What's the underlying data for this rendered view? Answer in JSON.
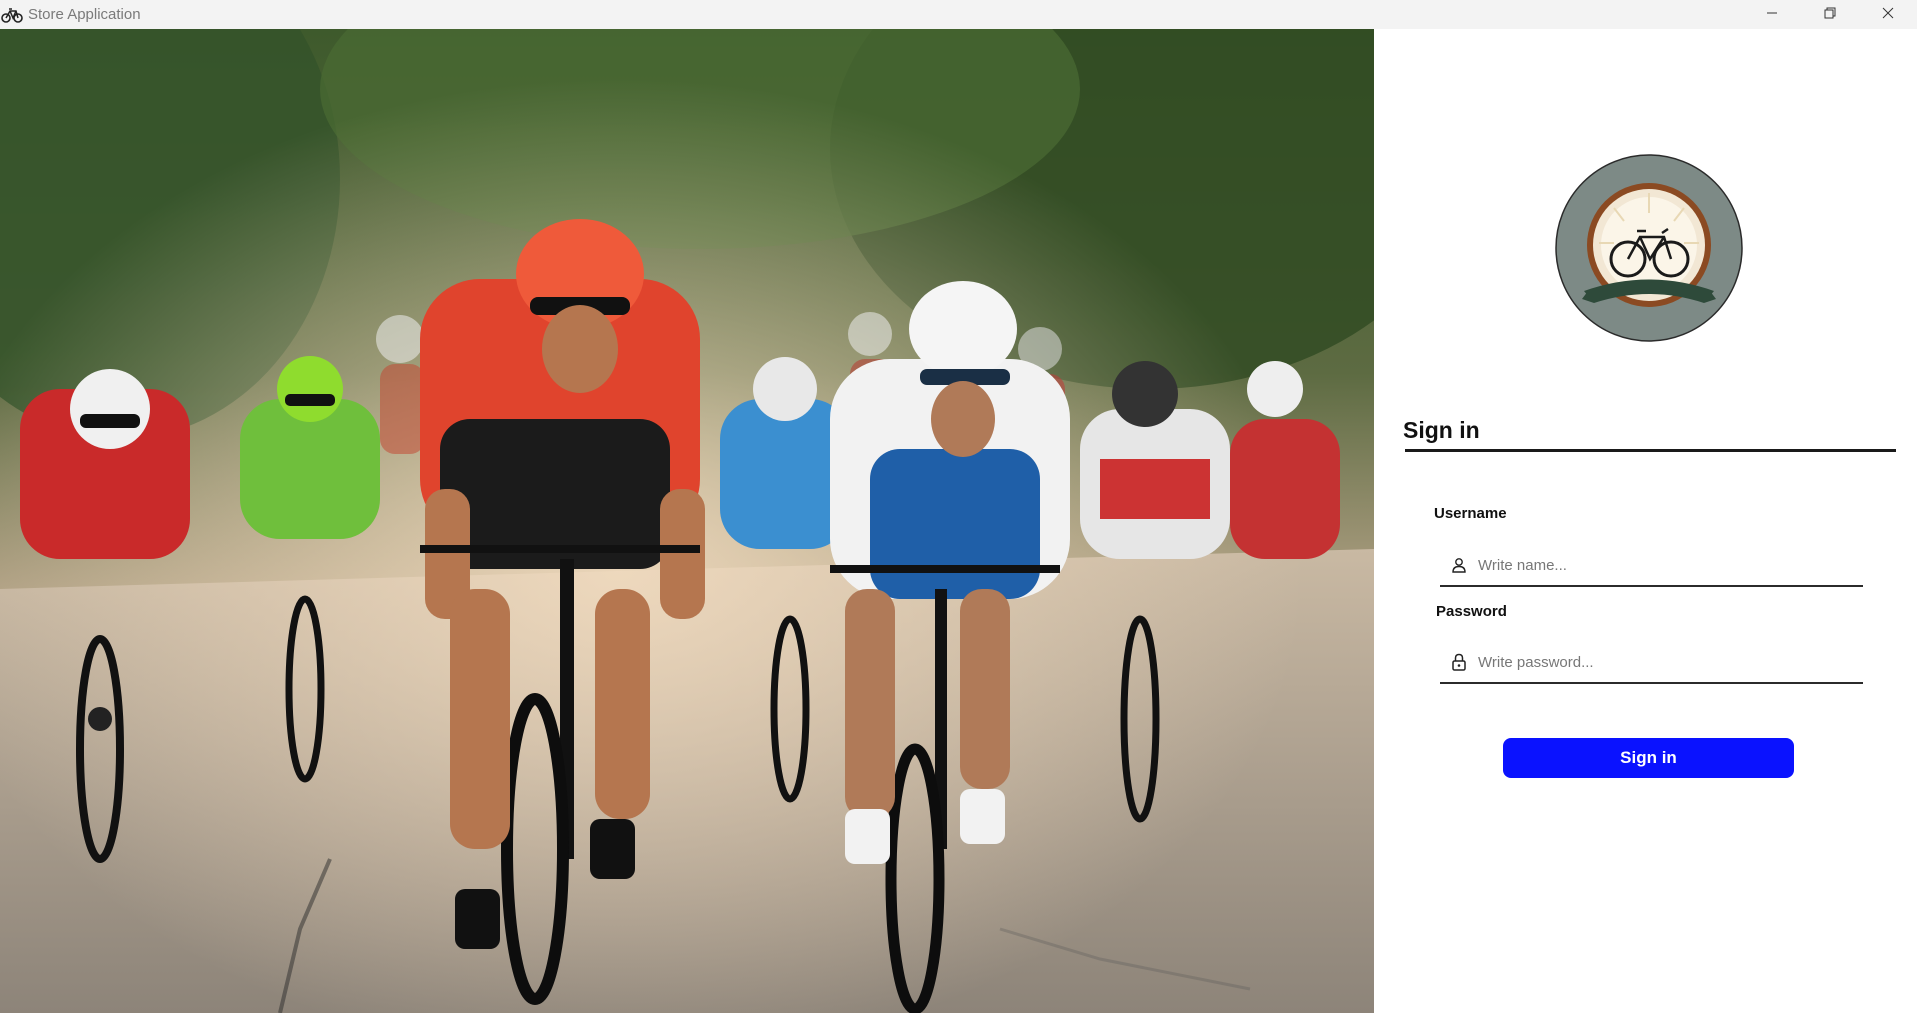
{
  "window": {
    "title": "Store Application",
    "app_icon": "bicycle-icon",
    "controls": [
      "minimize-icon",
      "restore-icon",
      "close-icon"
    ]
  },
  "hero": {
    "image": "photo of a group of road cyclists racing on a tree-lined road"
  },
  "logo": {
    "icon": "bicycle-logo-emblem"
  },
  "form": {
    "heading": "Sign in",
    "username": {
      "label": "Username",
      "placeholder": "Write name...",
      "value": "",
      "icon": "user-icon"
    },
    "password": {
      "label": "Password",
      "placeholder": "Write password...",
      "value": "",
      "icon": "lock-icon"
    },
    "submit_label": "Sign in"
  },
  "colors": {
    "primary_button": "#0a12ff",
    "titlebar": "#f3f3f3",
    "logo_circle": "#7d8a86"
  }
}
